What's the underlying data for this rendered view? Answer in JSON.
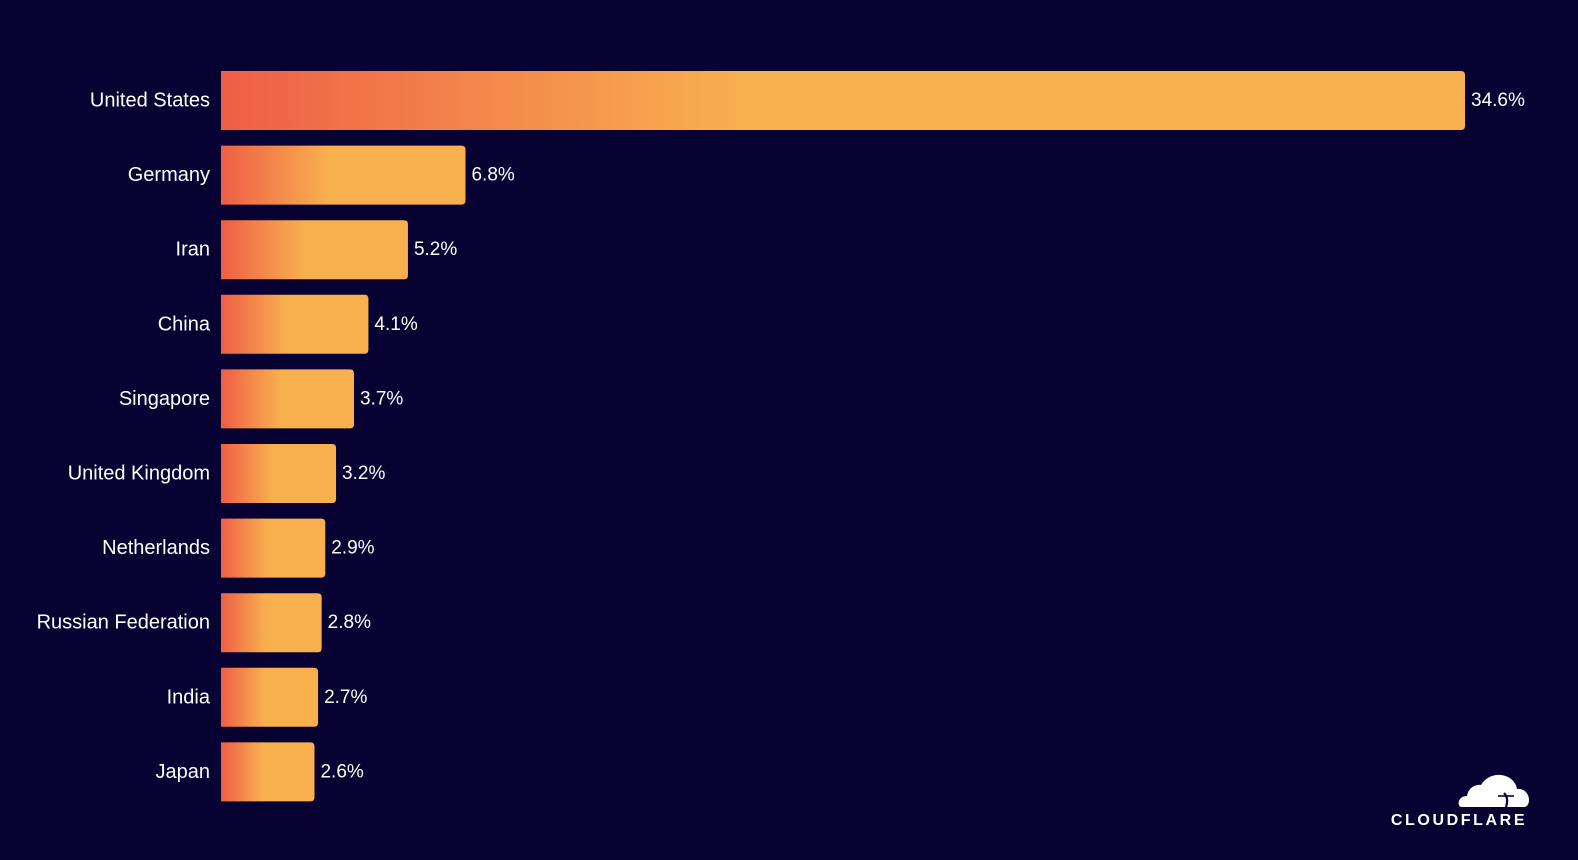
{
  "chart_data": {
    "type": "bar",
    "orientation": "horizontal",
    "title": "",
    "xlabel": "",
    "ylabel": "",
    "categories": [
      "United States",
      "Germany",
      "Iran",
      "China",
      "Singapore",
      "United Kingdom",
      "Netherlands",
      "Russian Federation",
      "India",
      "Japan"
    ],
    "values": [
      34.6,
      6.8,
      5.2,
      4.1,
      3.7,
      3.2,
      2.9,
      2.8,
      2.7,
      2.6
    ],
    "value_labels": [
      "34.6%",
      "6.8%",
      "5.2%",
      "4.1%",
      "3.7%",
      "3.2%",
      "2.9%",
      "2.8%",
      "2.7%",
      "2.6%"
    ],
    "unit": "%",
    "xlim": [
      0,
      34.6
    ],
    "grid": false,
    "legend": "none",
    "colors": {
      "background": "#080233",
      "bar_gradient_start": "#EF5E46",
      "bar_gradient_end": "#F8B04F",
      "text": "#FFFFFF"
    }
  },
  "branding": {
    "logo_text": "CLOUDFLARE",
    "logo_icon": "cloud-icon"
  }
}
